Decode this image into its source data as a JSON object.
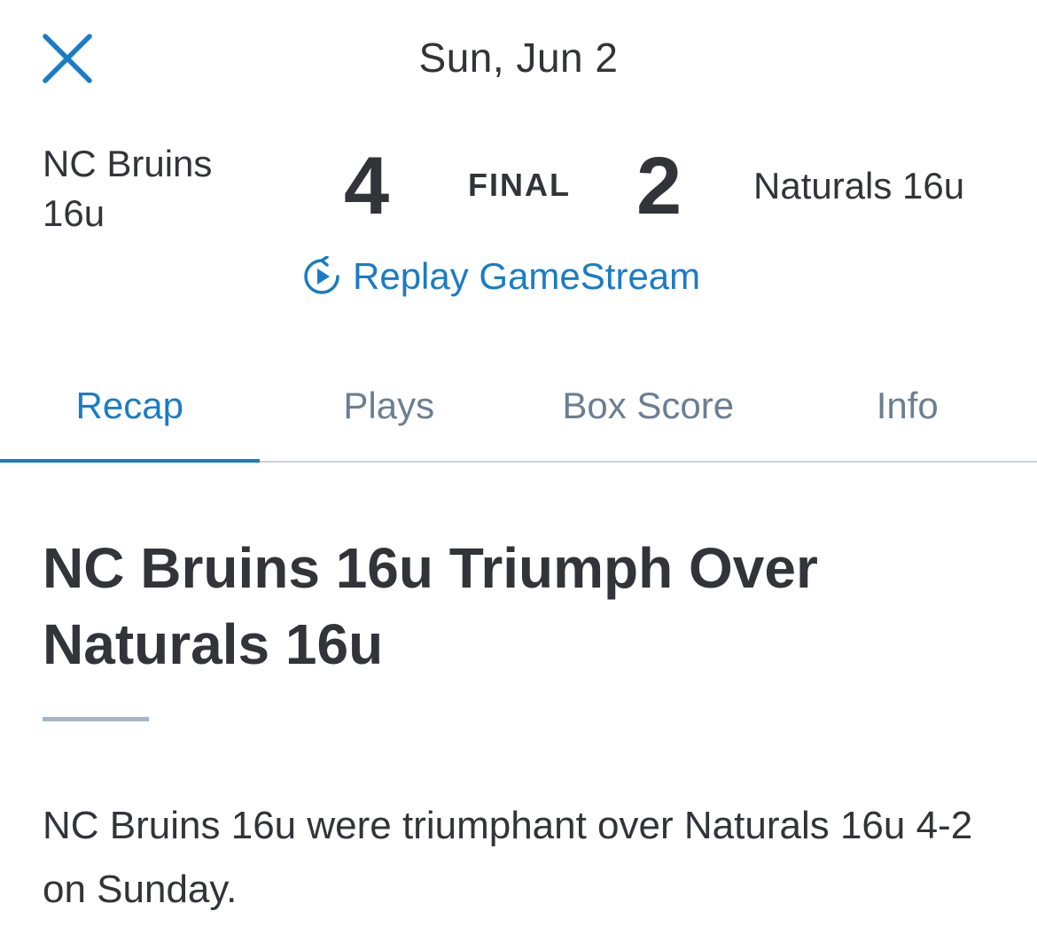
{
  "header": {
    "date": "Sun, Jun 2",
    "close_icon": "close-icon"
  },
  "scoreboard": {
    "home_team": "NC Bruins 16u",
    "home_score": "4",
    "status": "FINAL",
    "away_score": "2",
    "away_team": "Naturals 16u"
  },
  "replay": {
    "icon": "replay-icon",
    "label": "Replay GameStream"
  },
  "tabs": [
    {
      "label": "Recap",
      "active": true
    },
    {
      "label": "Plays",
      "active": false
    },
    {
      "label": "Box Score",
      "active": false
    },
    {
      "label": "Info",
      "active": false
    }
  ],
  "recap": {
    "title": "NC Bruins 16u Triumph Over Naturals 16u",
    "body": "NC Bruins 16u were triumphant over Naturals 16u 4-2 on Sunday."
  },
  "colors": {
    "accent": "#1a7cc4",
    "text": "#32343a",
    "tab_inactive": "#6b7f93",
    "divider": "#a7b6c4"
  }
}
